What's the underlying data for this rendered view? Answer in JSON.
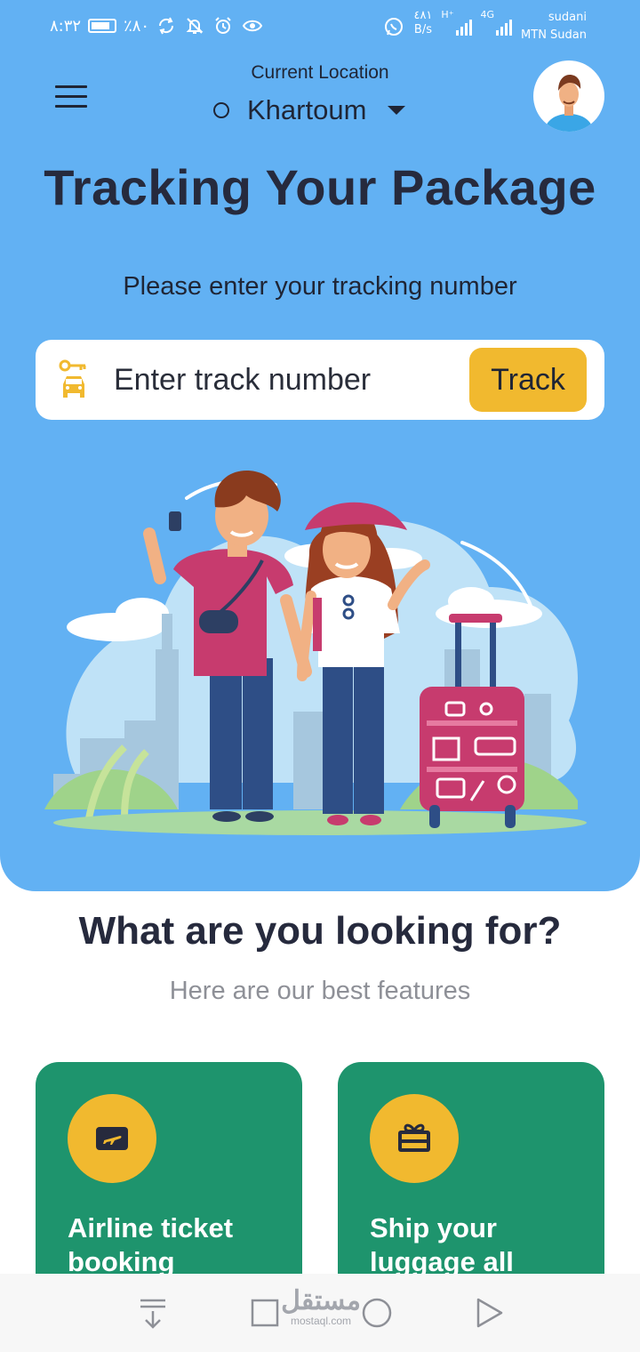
{
  "status_bar": {
    "time": "٨:٣٢",
    "battery_percent": "٪٨٠",
    "net_speed_value": "٤٨١",
    "net_speed_unit": "B/s",
    "signal_1_label": "H⁺",
    "signal_2_label": "4G",
    "carrier_1": "sudani",
    "carrier_2": "MTN Sudan"
  },
  "header": {
    "location_label": "Current Location",
    "location_value": "Khartoum"
  },
  "hero": {
    "title": "Tracking Your Package",
    "subtitle": "Please enter your tracking number",
    "search": {
      "placeholder": "Enter track number",
      "button_label": "Track"
    }
  },
  "features": {
    "title": "What are you looking for?",
    "subtitle": "Here are our best features",
    "cards": [
      {
        "label": "Airline ticket booking",
        "icon": "plane-ticket-icon"
      },
      {
        "label": "Ship your luggage all",
        "icon": "gift-box-icon"
      }
    ]
  },
  "watermark": {
    "text": "مستقل",
    "url": "mostaql.com"
  },
  "colors": {
    "hero_bg": "#62b1f3",
    "accent_yellow": "#f1b92f",
    "card_green": "#1e946d",
    "heading_dark": "#262a3d"
  }
}
